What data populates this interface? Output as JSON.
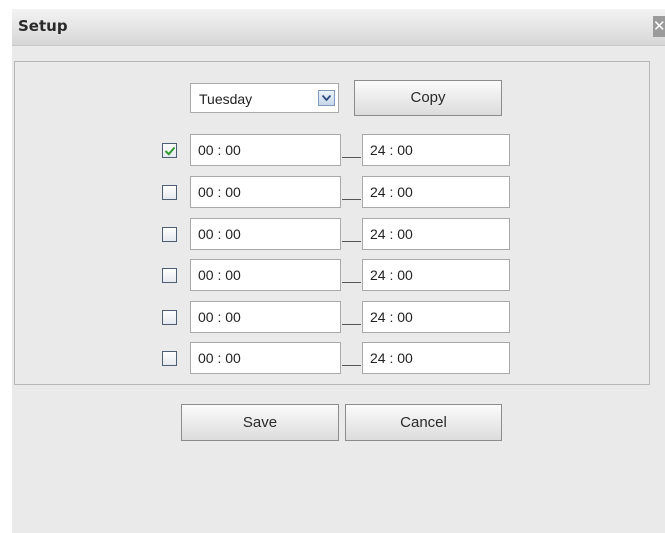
{
  "dialog": {
    "title": "Setup",
    "close_glyph": "✕"
  },
  "day_select": {
    "selected": "Tuesday",
    "arrow_icon": "chevron-down-icon"
  },
  "buttons": {
    "copy": "Copy",
    "save": "Save",
    "cancel": "Cancel"
  },
  "periods": [
    {
      "enabled": true,
      "start": "00 : 00",
      "end": "24 : 00"
    },
    {
      "enabled": false,
      "start": "00 : 00",
      "end": "24 : 00"
    },
    {
      "enabled": false,
      "start": "00 : 00",
      "end": "24 : 00"
    },
    {
      "enabled": false,
      "start": "00 : 00",
      "end": "24 : 00"
    },
    {
      "enabled": false,
      "start": "00 : 00",
      "end": "24 : 00"
    },
    {
      "enabled": false,
      "start": "00 : 00",
      "end": "24 : 00"
    }
  ],
  "colors": {
    "check_mark": "#2e9a2e"
  }
}
